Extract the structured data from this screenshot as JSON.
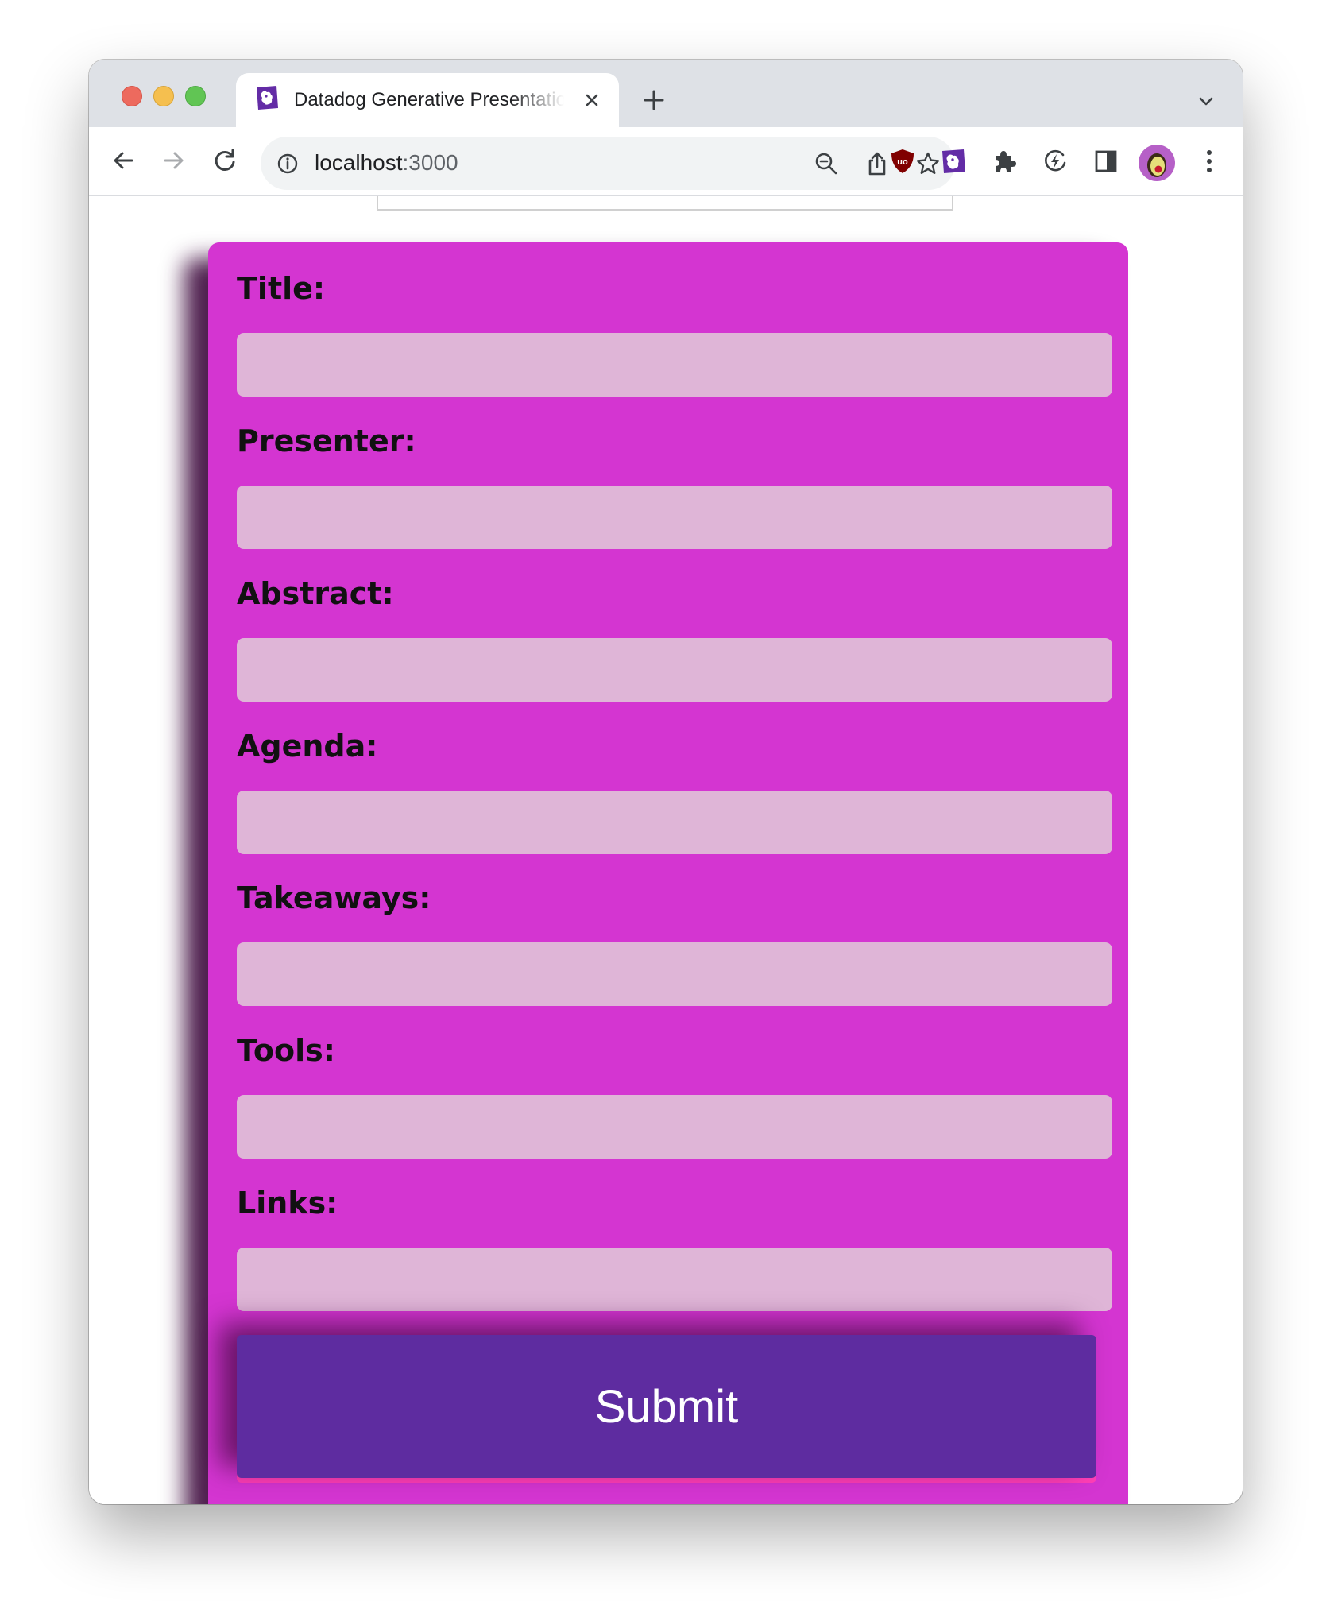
{
  "browser": {
    "tab_title": "Datadog Generative Presentation",
    "url_host": "localhost",
    "url_port": ":3000"
  },
  "colors": {
    "form_background": "#d435d1",
    "input_background": "#dfb5d7",
    "submit_background": "#5e2ca0",
    "submit_text": "#ffffff"
  },
  "form": {
    "fields": [
      {
        "label": "Title:",
        "value": ""
      },
      {
        "label": "Presenter:",
        "value": ""
      },
      {
        "label": "Abstract:",
        "value": ""
      },
      {
        "label": "Agenda:",
        "value": ""
      },
      {
        "label": "Takeaways:",
        "value": ""
      },
      {
        "label": "Tools:",
        "value": ""
      },
      {
        "label": "Links:",
        "value": ""
      }
    ],
    "submit_label": "Submit"
  },
  "icons": {
    "tab_favicon": "datadog-icon",
    "tab_close": "close-icon",
    "new_tab": "plus-icon",
    "tab_list": "chevron-down-icon",
    "back": "arrow-left-icon",
    "forward": "arrow-right-icon",
    "reload": "reload-icon",
    "site_info": "info-icon",
    "zoom": "zoom-out-icon",
    "share": "share-icon",
    "bookmark": "star-icon",
    "extensions": [
      "ublock-icon",
      "datadog-icon",
      "puzzle-icon",
      "bolt-icon",
      "side-panel-icon"
    ],
    "menu": "more-vertical-icon"
  }
}
